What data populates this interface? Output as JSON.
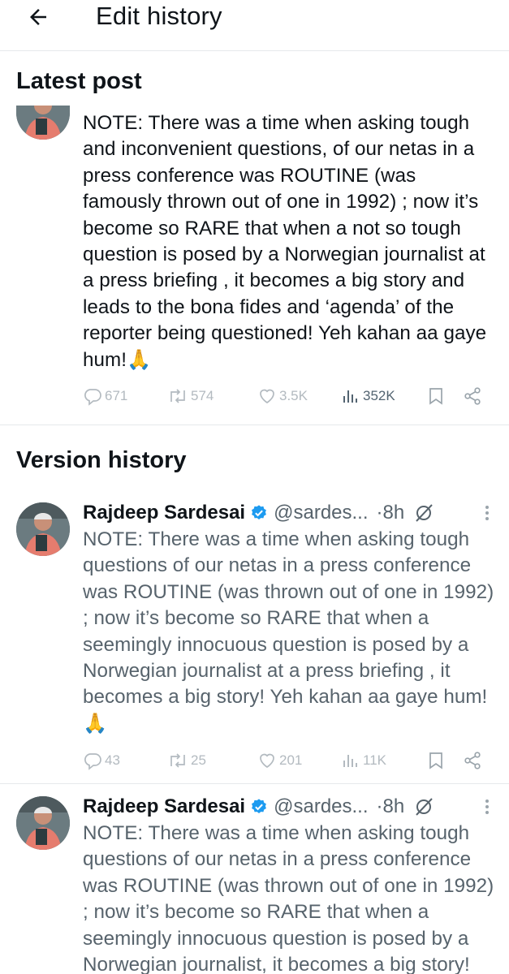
{
  "header": {
    "title": "Edit history",
    "back_icon": "arrow-left-icon"
  },
  "latest": {
    "section_title": "Latest post",
    "text": "NOTE: There was a time when asking tough and inconvenient questions, of our netas in a press conference was ROUTINE (was famously thrown out of one in 1992) ; now it’s become so RARE that when a not so tough question is posed by a Norwegian journalist at a press briefing , it becomes a big story and leads to the bona fides and ‘agenda’ of the reporter being questioned! Yeh kahan aa gaye hum!🙏",
    "metrics": {
      "replies": "671",
      "reposts": "574",
      "likes": "3.5K",
      "views": "352K"
    }
  },
  "history": {
    "section_title": "Version history",
    "versions": [
      {
        "author": "Rajdeep Sardesai",
        "handle": "@sardes...",
        "time": "·8h",
        "text": "NOTE: There was a time when asking tough questions of our netas in a press conference was ROUTINE (was thrown out of one in 1992) ; now it’s become so RARE that when a seemingly innocuous question is posed by a Norwegian journalist at a press briefing , it becomes a big story! Yeh kahan aa gaye hum! 🙏",
        "metrics": {
          "replies": "43",
          "reposts": "25",
          "likes": "201",
          "views": "11K"
        }
      },
      {
        "author": "Rajdeep Sardesai",
        "handle": "@sardes...",
        "time": "·8h",
        "text": "NOTE: There was a time when asking tough questions of our netas in a press conference was ROUTINE (was thrown out of one in 1992) ; now it’s become so RARE that when a seemingly innocuous question is posed by a Norwegian journalist, it becomes a big story!"
      }
    ]
  },
  "colors": {
    "verified_badge": "#1d9bf0",
    "muted_text": "#57636c",
    "action_icon": "#9aa4ab",
    "divider": "#e6e9eb"
  }
}
